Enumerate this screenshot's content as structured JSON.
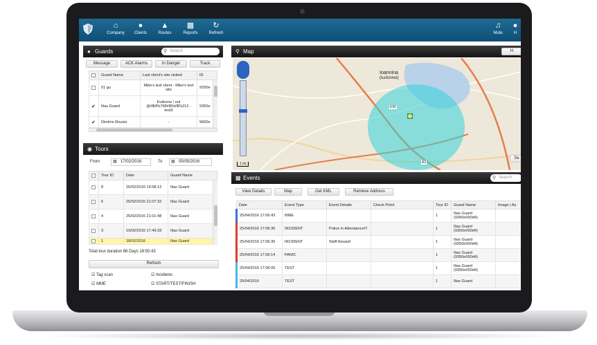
{
  "nav": {
    "items": [
      {
        "label": "Company",
        "icon": "home-icon"
      },
      {
        "label": "Clients",
        "icon": "user-icon"
      },
      {
        "label": "Routes",
        "icon": "road-icon"
      },
      {
        "label": "Reports",
        "icon": "chart-icon"
      },
      {
        "label": "Refresh",
        "icon": "refresh-icon"
      }
    ],
    "right": [
      {
        "label": "Mute",
        "icon": "speaker-icon"
      },
      {
        "label": "H",
        "icon": "help-icon"
      }
    ]
  },
  "guards": {
    "title": "Guards",
    "search_placeholder": "Search",
    "buttons": [
      "Message",
      "ACK Alarms",
      "In Danger",
      "Track"
    ],
    "columns": [
      "Guard Name",
      "Last client's site visited",
      "ID"
    ],
    "rows": [
      {
        "name": "51 gu",
        "site": "Mike's test client - Mike's test site",
        "id": "9250e",
        "checked": false
      },
      {
        "name": "Ilias Guard",
        "site": "Evdoxos / out @#$4%768#$%#$%212 - test3",
        "id": "9350e",
        "checked": true
      },
      {
        "name": "Dimitris Rousis",
        "site": "-",
        "id": "9660e",
        "checked": true
      }
    ]
  },
  "tours": {
    "title": "Tours",
    "from_label": "From",
    "from_value": "17/02/2016",
    "to_label": "To",
    "to_value": "05/05/2016",
    "columns": [
      "Tour ID",
      "Date",
      "Guard Name"
    ],
    "rows": [
      {
        "id": "8",
        "date": "26/02/2016 19:58:12",
        "guard": "Ilias Guard"
      },
      {
        "id": "6",
        "date": "25/02/2016 21:07:32",
        "guard": "Ilias Guard"
      },
      {
        "id": "4",
        "date": "25/02/2016 21:01:48",
        "guard": "Ilias Guard"
      },
      {
        "id": "3",
        "date": "19/02/2016 17:49:33",
        "guard": "Ilias Guard"
      },
      {
        "id": "1",
        "date": "18/02/2016",
        "guard": "Ilias Guard"
      }
    ],
    "total": "Total tour duration 68 Days 18:50:43",
    "refresh": "Refresh",
    "filters": [
      "Tag scan",
      "Incidents",
      "MME",
      "START/TEST/FINISH"
    ]
  },
  "map": {
    "title": "Map",
    "city": "Ioannina",
    "city_greek": "(Ιωάννινα)",
    "road_labels": [
      "E90",
      "A2"
    ],
    "scale": "1 mi",
    "right_button": "H",
    "right_button2": "Se"
  },
  "events": {
    "title": "Events",
    "search_placeholder": "Search",
    "buttons": [
      "View Details",
      "Map",
      "Get KML",
      "Retrieve Address"
    ],
    "columns": [
      "Date",
      "Event Type",
      "Event Details",
      "Check Point",
      "Tour ID",
      "Guard Name",
      "Image | As"
    ],
    "rows": [
      {
        "date": "25/04/2016 17:06:43",
        "type": "MME",
        "details": "",
        "checkpoint": "",
        "tour": "1",
        "guard": "Ilias Guard (9350e000d4)",
        "color": "#3b6fd6"
      },
      {
        "date": "25/04/2016 17:06:30",
        "type": "INCIDENT",
        "details": "Police in Attendance!!!",
        "checkpoint": "",
        "tour": "1",
        "guard": "Ilias Guard (9350e000d4)",
        "color": "#e03a2f"
      },
      {
        "date": "25/04/2016 17:06:30",
        "type": "INCIDENT",
        "details": "Staff Assault",
        "checkpoint": "",
        "tour": "1",
        "guard": "Ilias Guard (9350e000d4)",
        "color": "#e03a2f"
      },
      {
        "date": "25/04/2016 17:06:14",
        "type": "PANIC",
        "details": "",
        "checkpoint": "",
        "tour": "1",
        "guard": "Ilias Guard (9350e000d4)",
        "color": "#e03a2f"
      },
      {
        "date": "25/04/2016 17:06:06",
        "type": "TEST",
        "details": "",
        "checkpoint": "",
        "tour": "1",
        "guard": "Ilias Guard (9350e000d4)",
        "color": "#49b6e8"
      },
      {
        "date": "25/04/2016",
        "type": "TEST",
        "details": "",
        "checkpoint": "",
        "tour": "1",
        "guard": "Ilias Guard",
        "color": "#49b6e8"
      }
    ]
  }
}
